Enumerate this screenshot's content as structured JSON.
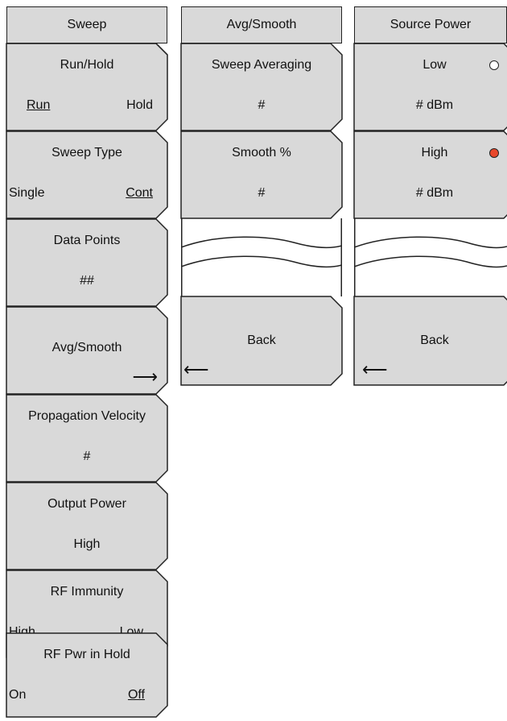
{
  "sweep_menu": {
    "title": "Sweep",
    "keys": [
      {
        "label": "Run/Hold",
        "left": "Run",
        "right": "Hold",
        "left_selected": true,
        "right_selected": false
      },
      {
        "label": "Sweep Type",
        "left": "Single",
        "right": "Cont",
        "left_selected": false,
        "right_selected": true
      },
      {
        "label": "Data Points",
        "value": "##"
      },
      {
        "label": "Avg/Smooth",
        "arrow": "⟶"
      },
      {
        "label": "Propagation Velocity",
        "value": "#"
      },
      {
        "label": "Output Power",
        "value": "High"
      },
      {
        "label": "RF Immunity",
        "left": "High",
        "right": "Low",
        "left_selected": false,
        "right_selected": true
      },
      {
        "label": "RF Pwr in Hold",
        "left": "On",
        "right": "Off",
        "left_selected": false,
        "right_selected": true
      }
    ]
  },
  "avg_menu": {
    "title": "Avg/Smooth",
    "keys": [
      {
        "label": "Sweep Averaging",
        "value": "#"
      },
      {
        "label": "Smooth %",
        "value": "#"
      }
    ],
    "back": {
      "label": "Back",
      "arrow": "⟵"
    }
  },
  "source_menu": {
    "title": "Source Power",
    "keys": [
      {
        "label": "Low",
        "value": "# dBm",
        "selected": false
      },
      {
        "label": "High",
        "value": "# dBm",
        "selected": true
      }
    ],
    "back": {
      "label": "Back",
      "arrow": "⟵"
    }
  },
  "colors": {
    "key_fill": "#d9d9d9",
    "border": "#222222",
    "selected_radio": "#e8472a"
  }
}
